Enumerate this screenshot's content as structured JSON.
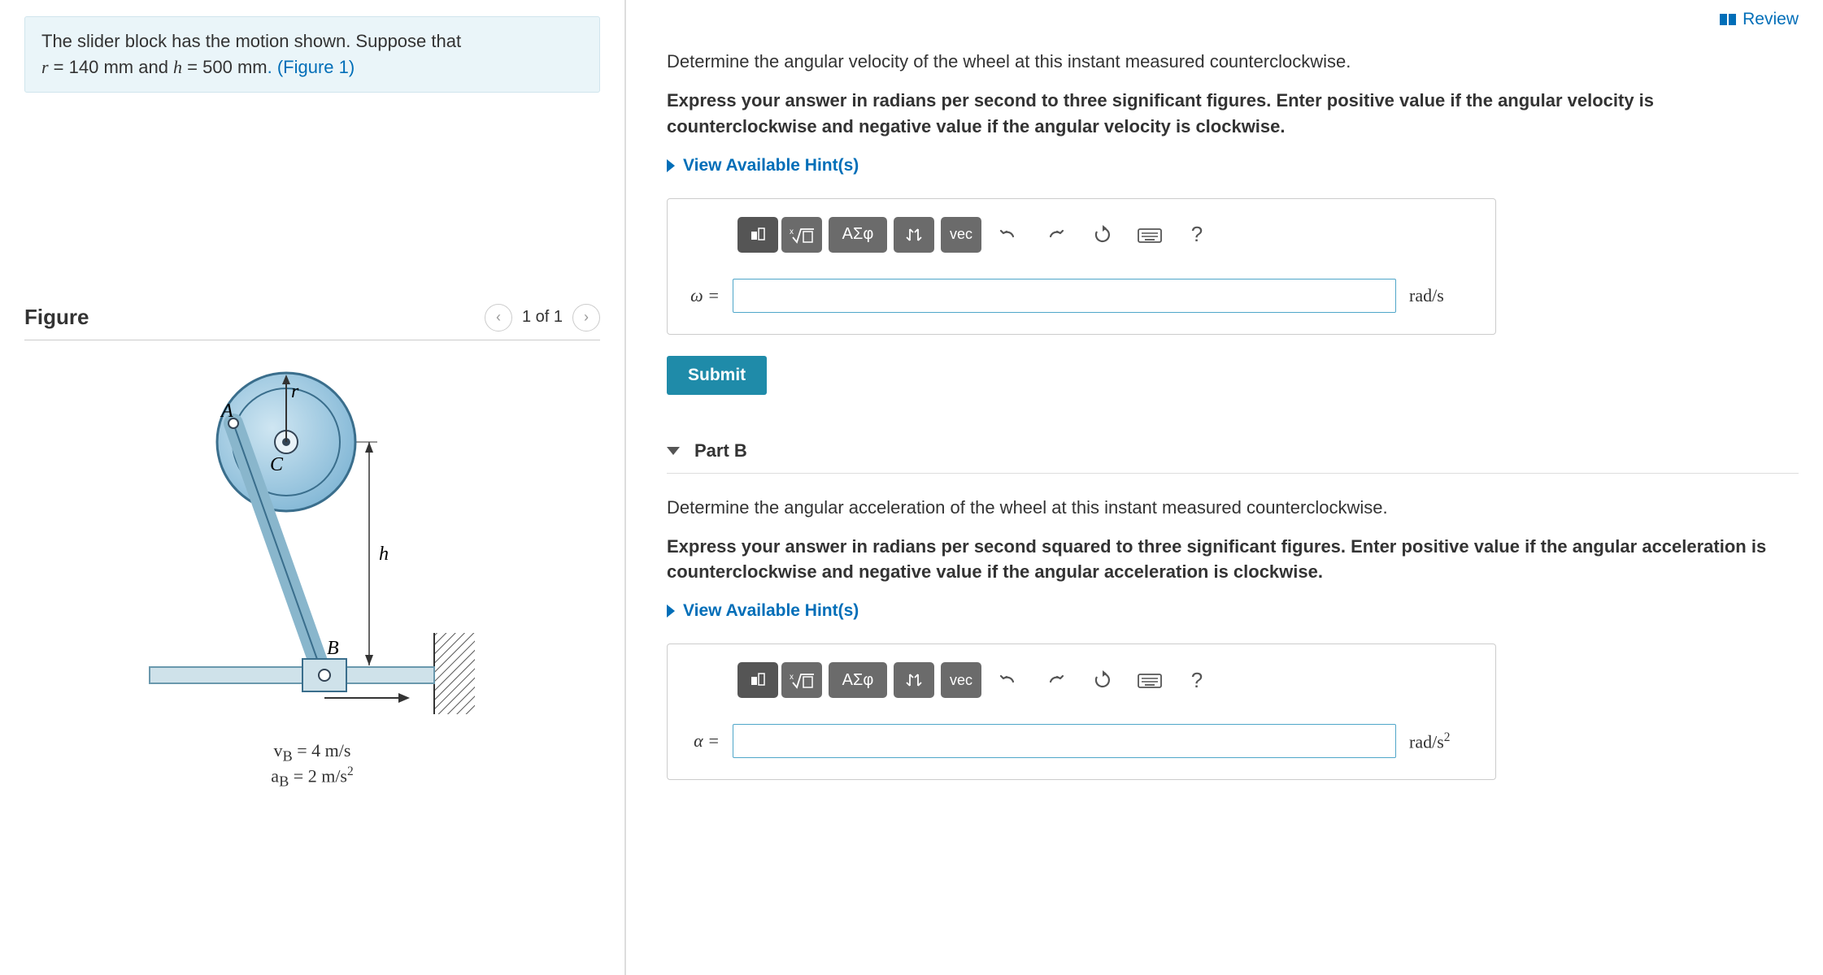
{
  "review": {
    "label": "Review"
  },
  "problem": {
    "line1": "The slider block has the motion shown. Suppose that",
    "r_var": "r",
    "r_eq": " = 140 mm",
    "and_text": " and ",
    "h_var": "h",
    "h_eq": " = 500 mm",
    "figref": ". (Figure 1)"
  },
  "figure": {
    "title": "Figure",
    "pager": "1 of 1",
    "labels": {
      "A": "A",
      "B": "B",
      "C": "C",
      "r": "r",
      "h": "h"
    },
    "eq_v": "v",
    "eq_v_sub": "B",
    "eq_v_rhs": " = 4 m/s",
    "eq_a": "a",
    "eq_a_sub": "B",
    "eq_a_rhs": " = 2 m/s"
  },
  "partA": {
    "question": "Determine the angular velocity of the wheel at this instant measured counterclockwise.",
    "instructions": "Express your answer in radians per second to three significant figures. Enter positive value if the angular velocity is counterclockwise and negative value if the angular velocity is clockwise.",
    "hints": "View Available Hint(s)",
    "var_label": "ω =",
    "unit": "rad/s",
    "value": ""
  },
  "partB": {
    "header": "Part B",
    "question": "Determine the angular acceleration of the wheel at this instant measured counterclockwise.",
    "instructions": "Express your answer in radians per second squared to three significant figures. Enter positive value if the angular acceleration is counterclockwise and negative value if the angular acceleration is clockwise.",
    "hints": "View Available Hint(s)",
    "var_label": "α =",
    "unit_prefix": "rad/s",
    "value": ""
  },
  "toolbar": {
    "greek": "ΑΣφ",
    "vec": "vec",
    "help": "?"
  },
  "actions": {
    "submit": "Submit"
  }
}
